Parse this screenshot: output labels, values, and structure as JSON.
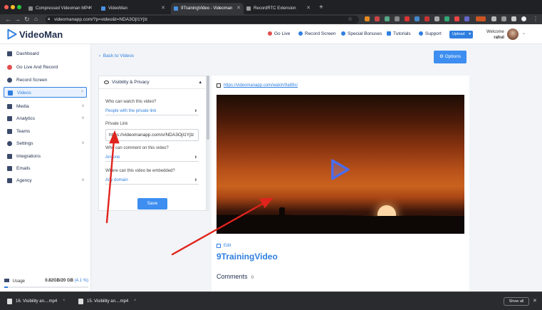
{
  "browser": {
    "tabs": [
      {
        "title": "Compressed Videoman MP4"
      },
      {
        "title": "VideoMan"
      },
      {
        "title": "9TrainingVideo - Videoman"
      },
      {
        "title": "RecordRTC Extension"
      }
    ],
    "url": "videomanapp.com/?p=video&t=NDA3OjI1Yjlz"
  },
  "header": {
    "brand": "VideoMan",
    "nav": [
      {
        "label": "Go Live",
        "icon": "broadcast-icon"
      },
      {
        "label": "Record Screen",
        "icon": "record-icon"
      },
      {
        "label": "Special Bonuses",
        "icon": "gift-icon"
      },
      {
        "label": "Tutorials",
        "icon": "video-icon"
      },
      {
        "label": "Support",
        "icon": "support-icon"
      }
    ],
    "upload_label": "Upload",
    "welcome": "Welcome",
    "user": "rahul"
  },
  "sidebar": {
    "items": [
      {
        "label": "Dashboard",
        "icon": "dashboard-icon"
      },
      {
        "label": "Go Live And Record",
        "icon": "broadcast-icon"
      },
      {
        "label": "Record Screen",
        "icon": "record-icon"
      },
      {
        "label": "Videos",
        "icon": "videos-icon",
        "chevron": "^"
      },
      {
        "label": "Media",
        "icon": "media-icon",
        "chevron": "v"
      },
      {
        "label": "Analytics",
        "icon": "analytics-icon",
        "chevron": "v"
      },
      {
        "label": "Teams",
        "icon": "teams-icon"
      },
      {
        "label": "Settings",
        "icon": "settings-icon",
        "chevron": "v"
      },
      {
        "label": "Integrations",
        "icon": "integrations-icon"
      },
      {
        "label": "Emails",
        "icon": "email-icon"
      },
      {
        "label": "Agency",
        "icon": "agency-icon",
        "chevron": "v"
      }
    ],
    "usage_label": "Usage",
    "usage_value": "0.82GB/20 GB",
    "usage_percent": "(4.1 %)",
    "usage_fraction": 0.041
  },
  "main": {
    "back_label": "Back to Videos",
    "options_label": "Options",
    "panel": {
      "title": "Visibility & Privacy",
      "who_watch_label": "Who can watch this video?",
      "who_watch_value": "People with the private link",
      "private_link_label": "Private Link",
      "private_link_value": "https://videomanapp.com/v/NDA3OjI1Yjlz",
      "comment_label": "Who can comment on this video?",
      "comment_value": "Anyone",
      "embed_label": "Where can this video be embedded?",
      "embed_value": "Any domain",
      "save_label": "Save"
    },
    "video_link": "https://videomanapp.com/watch/9a89s/",
    "edit_label": "Edit",
    "video_title": "9TrainingVideo",
    "comments_label": "Comments",
    "comments_count": "0"
  },
  "downloads": {
    "items": [
      {
        "name": "16. Visibility an....mp4"
      },
      {
        "name": "15. Visibility an....mp4"
      }
    ],
    "show_all_label": "Show all"
  },
  "colors": {
    "accent": "#2f7fe0",
    "annotation_arrow": "#e0231c"
  }
}
